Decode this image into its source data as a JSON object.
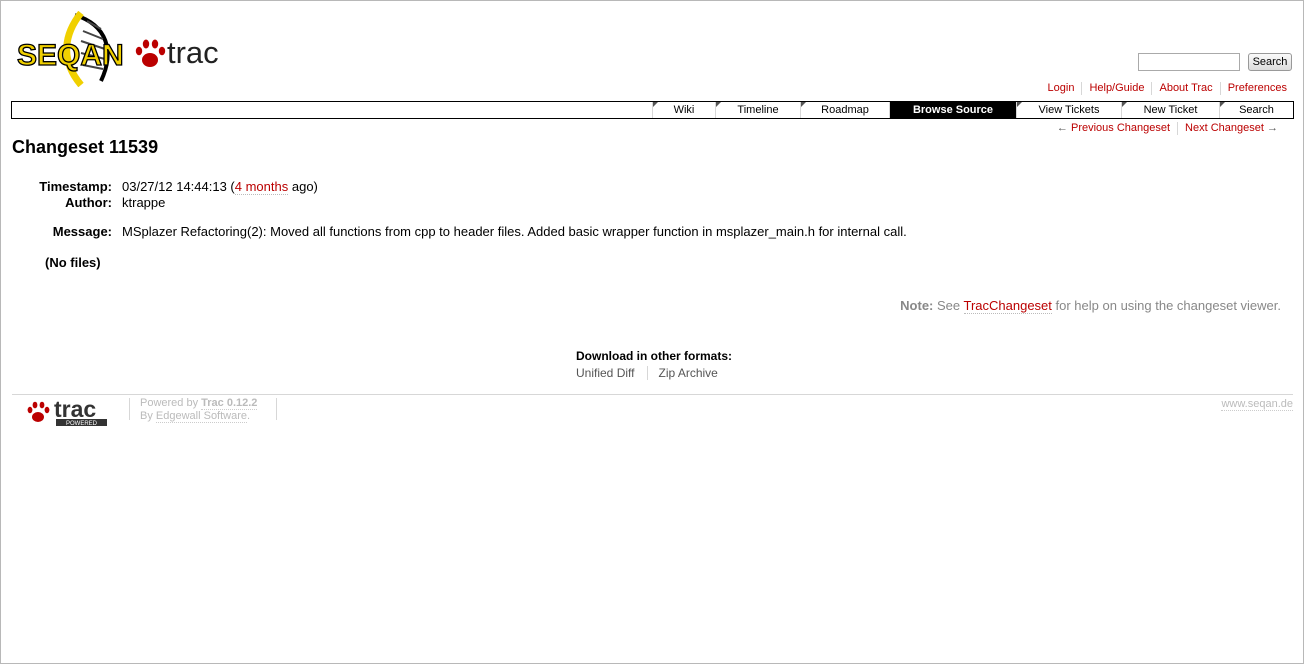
{
  "logo": {
    "seqan": "SEQAN",
    "trac": "trac"
  },
  "search": {
    "placeholder": "",
    "button_label": "Search"
  },
  "metanav": [
    "Login",
    "Help/Guide",
    "About Trac",
    "Preferences"
  ],
  "mainnav": [
    {
      "label": "Wiki",
      "active": false
    },
    {
      "label": "Timeline",
      "active": false
    },
    {
      "label": "Roadmap",
      "active": false
    },
    {
      "label": "Browse Source",
      "active": true
    },
    {
      "label": "View Tickets",
      "active": false
    },
    {
      "label": "New Ticket",
      "active": false
    },
    {
      "label": "Search",
      "active": false
    }
  ],
  "ctxtnav": {
    "prev_arrow": "←",
    "prev": "Previous Changeset",
    "next": "Next Changeset",
    "next_arrow": "→"
  },
  "page_title": "Changeset 11539",
  "props": {
    "timestamp_label": "Timestamp:",
    "timestamp_value": "03/27/12 14:44:13 (",
    "timestamp_link": "4 months",
    "timestamp_suffix": " ago)",
    "author_label": "Author:",
    "author_value": "ktrappe",
    "message_label": "Message:",
    "message_value": "MSplazer Refactoring(2): Moved all functions from cpp to header files. Added basic wrapper function in msplazer_main.h for internal call.",
    "no_files": "(No files)"
  },
  "note": {
    "label": "Note:",
    "pre": " See ",
    "link": "TracChangeset",
    "post": " for help on using the changeset viewer."
  },
  "download": {
    "title": "Download in other formats:",
    "links": [
      "Unified Diff",
      "Zip Archive"
    ]
  },
  "footer": {
    "logo_text": "trac",
    "logo_badge": "POWERED",
    "powered_by": "Powered by ",
    "trac_version": "Trac 0.12.2",
    "by": "By ",
    "edgewall": "Edgewall Software",
    "period": ".",
    "site": "www.seqan.de"
  },
  "colors": {
    "link": "#bb0000",
    "active_tab_bg": "#000000",
    "muted": "#888888",
    "logo_yellow": "#f0d000"
  }
}
